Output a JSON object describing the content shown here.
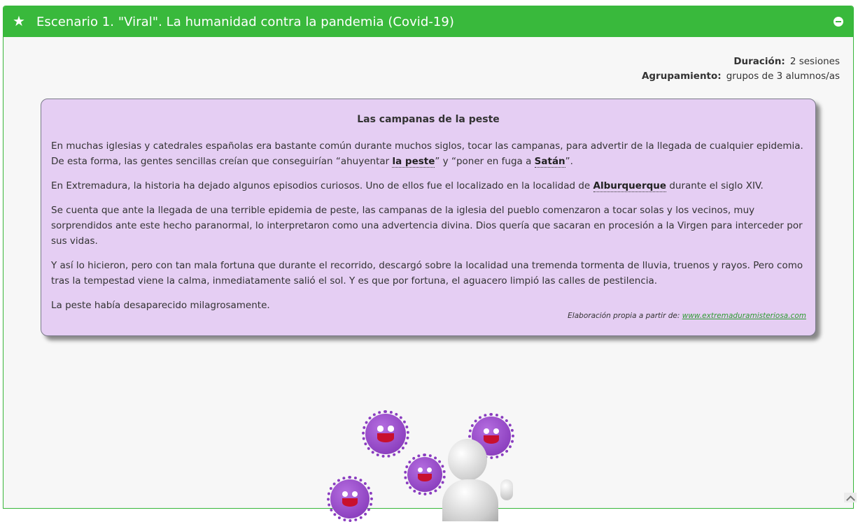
{
  "header": {
    "icon": "star-icon",
    "title": "Escenario 1. \"Viral\". La humanidad contra la pandemia (Covid-19)",
    "collapse_icon": "minus-circle-icon"
  },
  "meta": {
    "duration_label": "Duración:",
    "duration_value": "2 sesiones",
    "grouping_label": "Agrupamiento:",
    "grouping_value": "grupos de 3 alumnos/as"
  },
  "card": {
    "title": "Las campanas de la peste",
    "p1_a": "En muchas iglesias y catedrales españolas era bastante común durante muchos siglos, tocar las campanas, para advertir de la llegada de cualquier epidemia. De esta forma, las gentes sencillas creían que conseguirían “ahuyentar ",
    "p1_link1": "la peste",
    "p1_b": "” y “poner en fuga a ",
    "p1_link2": "Satán",
    "p1_c": "”.",
    "p2_a": "En Extremadura, la historia ha dejado algunos episodios curiosos. Uno de ellos fue el localizado en la localidad de ",
    "p2_link": "Alburquerque",
    "p2_b": " durante el siglo XIV.",
    "p3": "Se cuenta que ante la llegada de una terrible epidemia de peste, las campanas de la iglesia del pueblo comenzaron a tocar solas y los vecinos, muy sorprendidos ante este hecho paranormal, lo interpretaron como una advertencia divina. Dios quería que sacaran en procesión a la Virgen para interceder por sus vidas.",
    "p4": "Y así lo hicieron, pero con tan mala fortuna que durante el recorrido, descargó sobre la localidad una tremenda tormenta de lluvia, truenos y rayos. Pero como tras la tempestad viene la calma, inmediatamente salió el sol. Y es que por fortuna, el aguacero limpió las calles de pestilencia.",
    "p5": "La peste había desaparecido milagrosamente.",
    "credit_text": "Elaboración propia a partir de: ",
    "credit_link": "www.extremaduramisteriosa.com"
  },
  "colors": {
    "header_green": "#39b93c",
    "card_purple": "#e5cef3",
    "virus_purple": "#9b4fd0"
  }
}
